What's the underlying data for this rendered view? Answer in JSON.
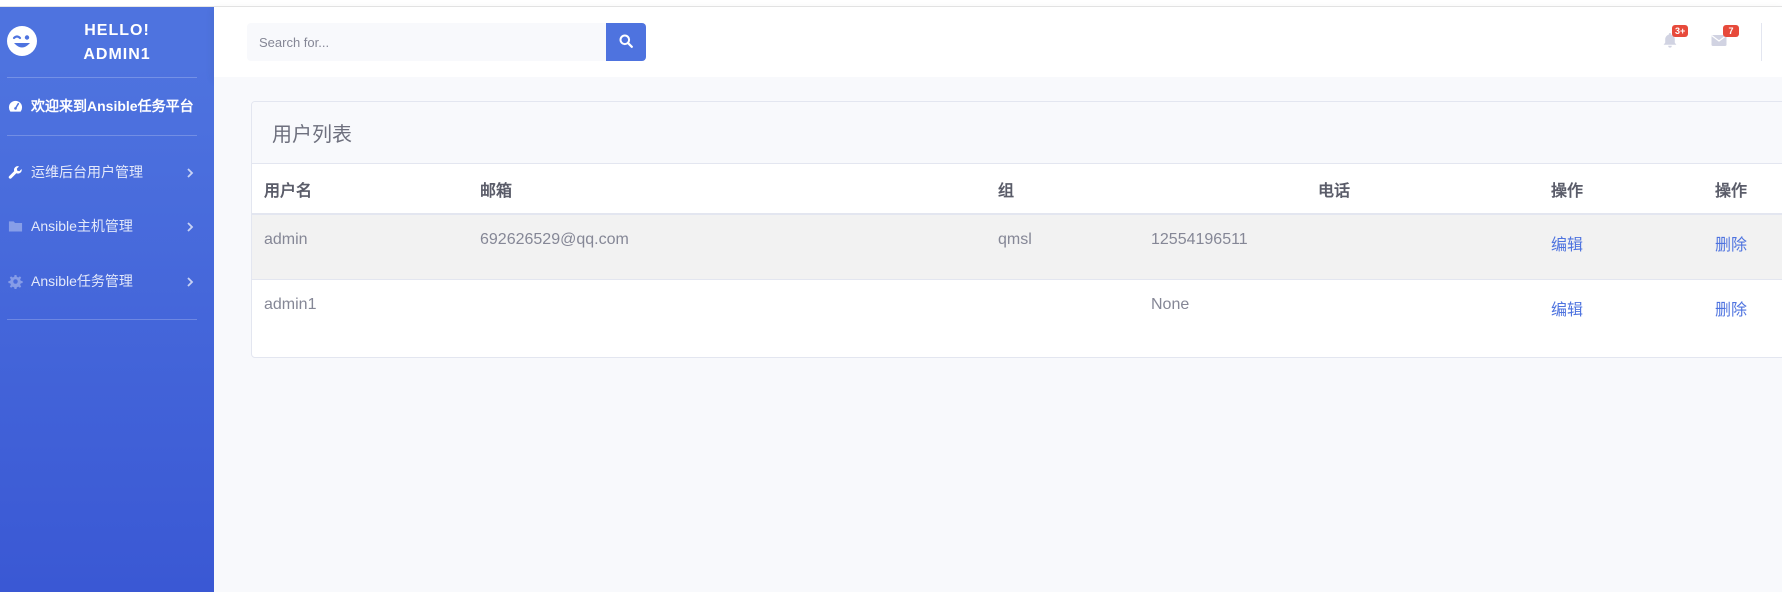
{
  "sidebar": {
    "brand": {
      "line1": "HELLO!",
      "line2": "ADMIN1",
      "icon": "grin-wink-icon"
    },
    "dashboard": {
      "label": "欢迎来到Ansible任务平台",
      "icon": "tachometer-icon"
    },
    "items": [
      {
        "label": "运维后台用户管理",
        "icon": "wrench-icon"
      },
      {
        "label": "Ansible主机管理",
        "icon": "folder-icon"
      },
      {
        "label": "Ansible任务管理",
        "icon": "cog-icon"
      }
    ]
  },
  "topbar": {
    "search": {
      "placeholder": "Search for..."
    },
    "alerts": {
      "badge": "3+",
      "icon": "bell-icon"
    },
    "messages": {
      "badge": "7",
      "icon": "envelope-icon"
    }
  },
  "main": {
    "card_title": "用户列表",
    "table": {
      "headers": [
        "用户名",
        "邮箱",
        "组",
        "电话",
        "操作",
        "操作"
      ],
      "rows": [
        {
          "username": "admin",
          "email": "692626529@qq.com",
          "group": "qmsl",
          "phone": "12554196511",
          "edit": "编辑",
          "delete": "删除"
        },
        {
          "username": "admin1",
          "email": "",
          "group": "",
          "phone": "None",
          "edit": "编辑",
          "delete": "删除"
        }
      ]
    }
  },
  "colors": {
    "primary": "#4e73df",
    "sidebar_bottom": "#3a58d4",
    "badge": "#e74a3b",
    "page_bg": "#f8f9fc"
  }
}
